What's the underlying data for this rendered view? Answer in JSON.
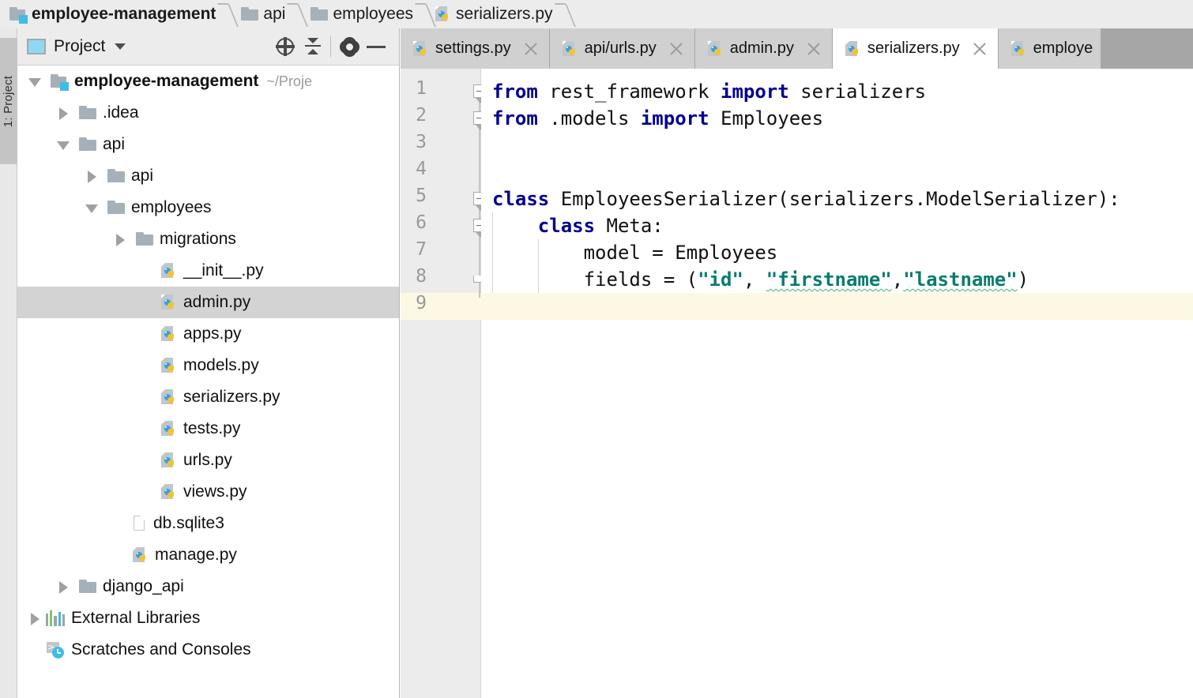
{
  "breadcrumb": {
    "items": [
      {
        "label": "employee-management",
        "icon": "folder-root-icon",
        "bold": true
      },
      {
        "label": "api",
        "icon": "folder-icon",
        "bold": false
      },
      {
        "label": "employees",
        "icon": "folder-icon",
        "bold": false
      },
      {
        "label": "serializers.py",
        "icon": "python-file-icon",
        "bold": false
      }
    ]
  },
  "tool_strip": {
    "project_button_label": "1: Project"
  },
  "project_panel": {
    "toolbar": {
      "title": "Project",
      "dropdown_icon": "chevron-down-icon",
      "window_icon": "project-window-icon",
      "locate_icon": "locate-target-icon",
      "collapse_icon": "collapse-all-icon",
      "settings_icon": "gear-icon",
      "hide_icon": "minimize-icon"
    },
    "tree": [
      {
        "label": "employee-management",
        "path": "~/Proje",
        "icon": "folder-root-icon",
        "depth": 0,
        "arrow": "down",
        "bold": true,
        "selected": false
      },
      {
        "label": ".idea",
        "path": "",
        "icon": "folder-icon",
        "depth": 1,
        "arrow": "right",
        "bold": false,
        "selected": false
      },
      {
        "label": "api",
        "path": "",
        "icon": "folder-icon",
        "depth": 1,
        "arrow": "down",
        "bold": false,
        "selected": false
      },
      {
        "label": "api",
        "path": "",
        "icon": "folder-icon",
        "depth": 2,
        "arrow": "right",
        "bold": false,
        "selected": false
      },
      {
        "label": "employees",
        "path": "",
        "icon": "folder-icon",
        "depth": 2,
        "arrow": "down",
        "bold": false,
        "selected": false
      },
      {
        "label": "migrations",
        "path": "",
        "icon": "folder-icon",
        "depth": 3,
        "arrow": "right",
        "bold": false,
        "selected": false
      },
      {
        "label": "__init__.py",
        "path": "",
        "icon": "python-file-icon",
        "depth": 4,
        "arrow": "none",
        "bold": false,
        "selected": false
      },
      {
        "label": "admin.py",
        "path": "",
        "icon": "python-file-icon",
        "depth": 4,
        "arrow": "none",
        "bold": false,
        "selected": true
      },
      {
        "label": "apps.py",
        "path": "",
        "icon": "python-file-icon",
        "depth": 4,
        "arrow": "none",
        "bold": false,
        "selected": false
      },
      {
        "label": "models.py",
        "path": "",
        "icon": "python-file-icon",
        "depth": 4,
        "arrow": "none",
        "bold": false,
        "selected": false
      },
      {
        "label": "serializers.py",
        "path": "",
        "icon": "python-file-icon",
        "depth": 4,
        "arrow": "none",
        "bold": false,
        "selected": false
      },
      {
        "label": "tests.py",
        "path": "",
        "icon": "python-file-icon",
        "depth": 4,
        "arrow": "none",
        "bold": false,
        "selected": false
      },
      {
        "label": "urls.py",
        "path": "",
        "icon": "python-file-icon",
        "depth": 4,
        "arrow": "none",
        "bold": false,
        "selected": false
      },
      {
        "label": "views.py",
        "path": "",
        "icon": "python-file-icon",
        "depth": 4,
        "arrow": "none",
        "bold": false,
        "selected": false
      },
      {
        "label": "db.sqlite3",
        "path": "",
        "icon": "file-icon",
        "depth": 3,
        "arrow": "none",
        "bold": false,
        "selected": false
      },
      {
        "label": "manage.py",
        "path": "",
        "icon": "python-file-icon",
        "depth": 3,
        "arrow": "none",
        "bold": false,
        "selected": false
      },
      {
        "label": "django_api",
        "path": "",
        "icon": "folder-icon",
        "depth": 1,
        "arrow": "right",
        "bold": false,
        "selected": false
      },
      {
        "label": "External Libraries",
        "path": "",
        "icon": "libraries-icon",
        "depth": 0,
        "arrow": "right",
        "bold": false,
        "selected": false
      },
      {
        "label": "Scratches and Consoles",
        "path": "",
        "icon": "scratches-icon",
        "depth": 0,
        "arrow": "none",
        "bold": false,
        "selected": false
      }
    ]
  },
  "editor": {
    "tabs": [
      {
        "label": "settings.py",
        "active": false,
        "icon": "python-file-icon",
        "closable": true
      },
      {
        "label": "api/urls.py",
        "active": false,
        "icon": "python-file-icon",
        "closable": true
      },
      {
        "label": "admin.py",
        "active": false,
        "icon": "python-file-icon",
        "closable": true
      },
      {
        "label": "serializers.py",
        "active": true,
        "icon": "python-file-icon",
        "closable": true
      },
      {
        "label": "employe",
        "active": false,
        "icon": "python-file-icon",
        "closable": false
      }
    ],
    "gutter_numbers": [
      "1",
      "2",
      "3",
      "4",
      "5",
      "6",
      "7",
      "8",
      "9"
    ],
    "current_line": 9,
    "code_lines": [
      {
        "n": 1,
        "segments": [
          {
            "t": "from ",
            "c": "kw"
          },
          {
            "t": "rest_framework ",
            "c": ""
          },
          {
            "t": "import ",
            "c": "kw"
          },
          {
            "t": "serializers",
            "c": ""
          }
        ]
      },
      {
        "n": 2,
        "segments": [
          {
            "t": "from ",
            "c": "kw"
          },
          {
            "t": ".models ",
            "c": ""
          },
          {
            "t": "import ",
            "c": "kw"
          },
          {
            "t": "Employees",
            "c": ""
          }
        ]
      },
      {
        "n": 3,
        "segments": []
      },
      {
        "n": 4,
        "segments": []
      },
      {
        "n": 5,
        "segments": [
          {
            "t": "class ",
            "c": "kw"
          },
          {
            "t": "EmployeesSerializer(serializers.ModelSerializer):",
            "c": ""
          }
        ]
      },
      {
        "n": 6,
        "segments": [
          {
            "t": "    ",
            "c": ""
          },
          {
            "t": "class ",
            "c": "kw"
          },
          {
            "t": "Meta:",
            "c": ""
          }
        ]
      },
      {
        "n": 7,
        "segments": [
          {
            "t": "        model = Employees",
            "c": ""
          }
        ]
      },
      {
        "n": 8,
        "segments": [
          {
            "t": "        fields = (",
            "c": ""
          },
          {
            "t": "\"id\"",
            "c": "str"
          },
          {
            "t": ", ",
            "c": ""
          },
          {
            "t": "\"firstname\"",
            "c": "str wavy"
          },
          {
            "t": ",",
            "c": ""
          },
          {
            "t": "\"lastname\"",
            "c": "str wavy"
          },
          {
            "t": ")",
            "c": ""
          }
        ]
      },
      {
        "n": 9,
        "segments": []
      }
    ]
  },
  "colors": {
    "keyword": "#00008f",
    "string": "#067d6e",
    "current_line_bg": "#fcf8e4",
    "selection_bg": "#d3d3d3",
    "accent": "#3dbde8"
  }
}
